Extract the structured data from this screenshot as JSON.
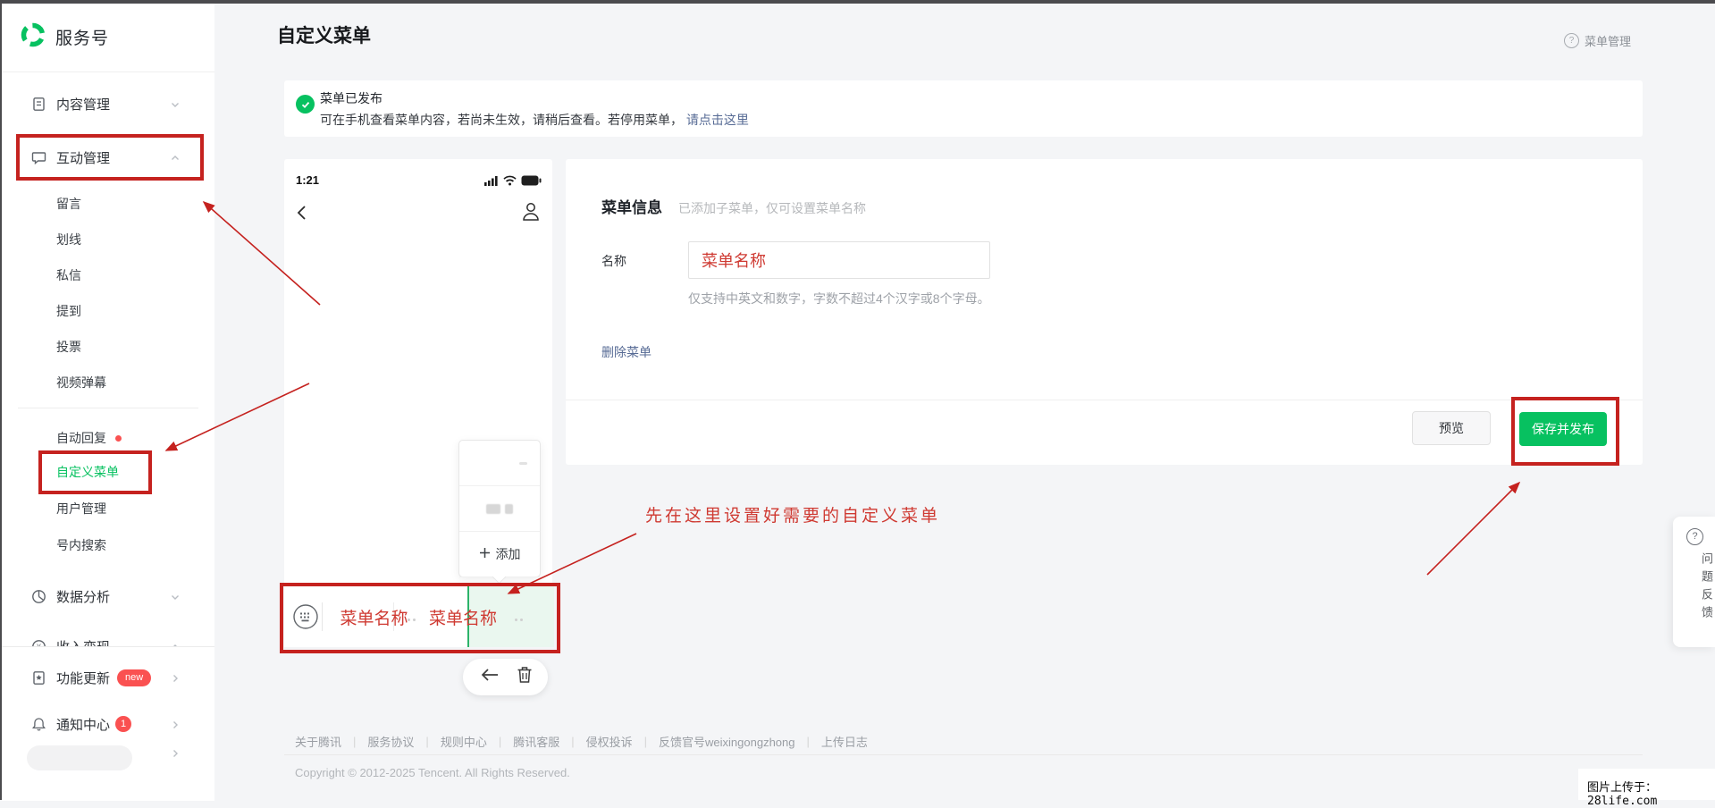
{
  "sidebar": {
    "brand": "服务号",
    "content_mgmt": "内容管理",
    "interact_mgmt": "互动管理",
    "sub": [
      "留言",
      "划线",
      "私信",
      "提到",
      "投票",
      "视频弹幕"
    ],
    "auto_reply": "自动回复",
    "custom_menu": "自定义菜单",
    "user_mgmt": "用户管理",
    "account_search": "号内搜索",
    "data_analysis": "数据分析",
    "monetization": "收入变现",
    "feature_update": "功能更新",
    "feature_badge": "new",
    "notification": "通知中心",
    "notification_badge": "1"
  },
  "header": {
    "title": "自定义菜单",
    "menu_mgmt": "菜单管理",
    "help_glyph": "?"
  },
  "banner": {
    "title": "菜单已发布",
    "desc": "可在手机查看菜单内容，若尚未生效，请稍后查看。若停用菜单，",
    "link": "请点击这里"
  },
  "phone": {
    "time": "1:21",
    "add_label": "添加",
    "menu1": "菜单名称",
    "menu2": "菜单名称"
  },
  "form": {
    "section_title": "菜单信息",
    "section_hint": "已添加子菜单，仅可设置菜单名称",
    "name_label": "名称",
    "name_value": "菜单名称",
    "name_hint": "仅支持中英文和数字，字数不超过4个汉字或8个字母。",
    "delete_link": "删除菜单",
    "preview_btn": "预览",
    "save_btn": "保存并发布"
  },
  "annotation": {
    "tip": "先在这里设置好需要的自定义菜单"
  },
  "footer": {
    "links": [
      "关于腾讯",
      "服务协议",
      "规则中心",
      "腾讯客服",
      "侵权投诉",
      "反馈官号weixingongzhong",
      "上传日志"
    ],
    "separator": "|",
    "copyright": "Copyright © 2012-2025 Tencent. All Rights Reserved."
  },
  "feedback": {
    "help_glyph": "?",
    "label": "问题反馈"
  },
  "watermark": {
    "text": "图片上传于：28life.com"
  },
  "colors": {
    "brand_green": "#07c160",
    "annotation_red": "#c5221f",
    "link_blue": "#576b95",
    "badge_red": "#fa5151",
    "selected_menu_bg": "#eaf7ef"
  }
}
